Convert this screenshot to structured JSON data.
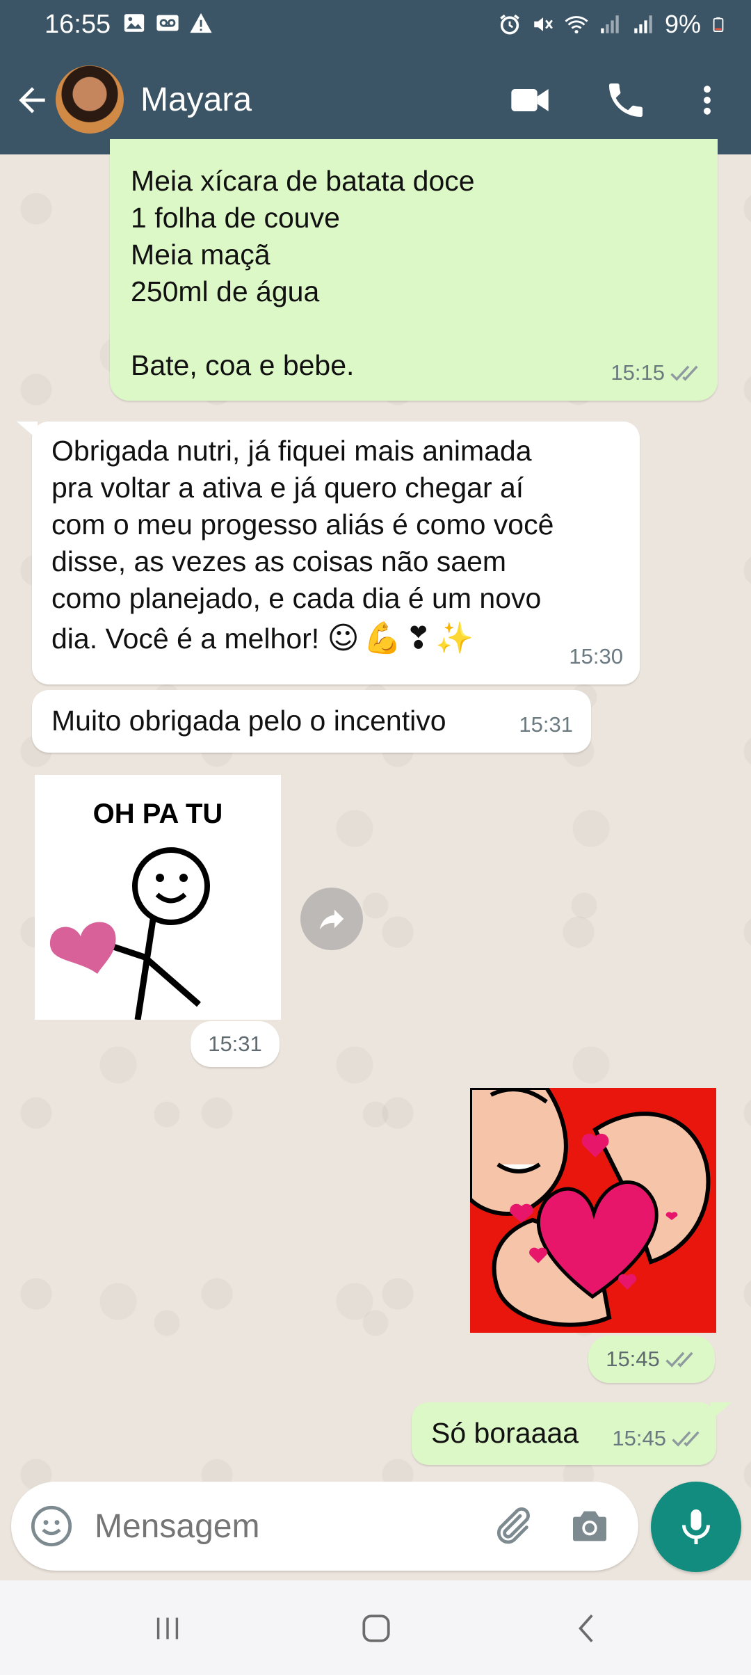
{
  "status_bar": {
    "time": "16:55",
    "battery": "9%"
  },
  "header": {
    "contact_name": "Mayara"
  },
  "messages": [
    {
      "direction": "outgoing",
      "lines": [
        "Meia xícara de batata doce",
        "1 folha de couve",
        "Meia maçã",
        "250ml de água",
        "",
        "Bate, coa e bebe."
      ],
      "time": "15:15",
      "status": "read"
    },
    {
      "direction": "incoming",
      "lines": [
        "Obrigada nutri, já fiquei mais animada",
        "pra voltar a ativa e já quero chegar aí",
        "com o meu progesso aliás é como você",
        "disse, as vezes as coisas não saem",
        "como planejado, e cada dia é um novo",
        "dia. Você é a melhor!"
      ],
      "emojis": "☺💪❣✨",
      "time": "15:30"
    },
    {
      "direction": "incoming",
      "text": "Muito obrigada pelo o incentivo",
      "time": "15:31"
    },
    {
      "direction": "incoming",
      "type": "sticker",
      "sticker_text": "OH PA TU",
      "time": "15:31"
    },
    {
      "direction": "outgoing",
      "type": "sticker",
      "time": "15:45",
      "status": "read"
    },
    {
      "direction": "outgoing",
      "text": "Só boraaaa",
      "time": "15:45",
      "status": "read"
    }
  ],
  "composer": {
    "placeholder": "Mensagem"
  },
  "colors": {
    "header": "#3c5566",
    "outgoing_bubble": "#dcf8c6",
    "incoming_bubble": "#ffffff",
    "read_ticks": "#8e9aa0",
    "mic_button": "#128c7e",
    "chat_background": "#ece5dd"
  },
  "icons": {
    "header": [
      "back-arrow-icon",
      "video-call-icon",
      "phone-icon",
      "more-vert-icon"
    ],
    "composer": [
      "emoji-icon",
      "attach-icon",
      "camera-icon",
      "mic-icon"
    ],
    "navbar": [
      "recents-icon",
      "home-icon",
      "back-icon"
    ]
  }
}
